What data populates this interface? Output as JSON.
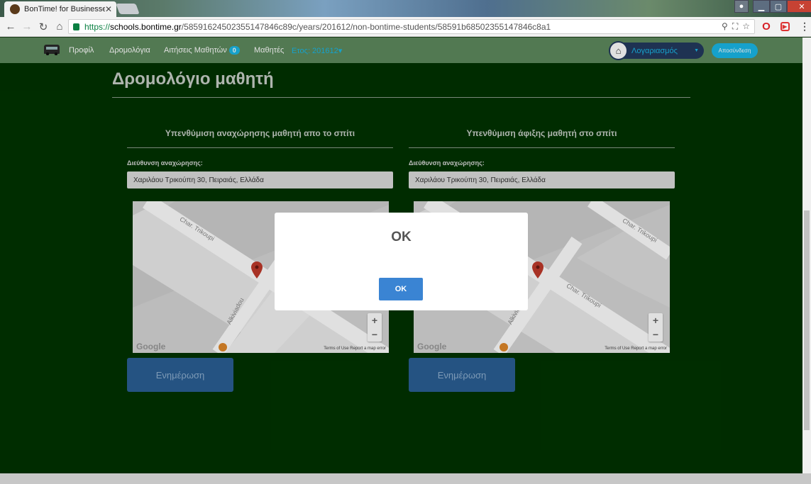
{
  "browser": {
    "tab_title": "BonTime! for Businesses",
    "tab_close": "✕",
    "url_scheme": "https://",
    "url_host": "schools.bontime.gr",
    "url_path": "/58591624502355147846c89c/years/201612/non-bontime-students/58591b68502355147846c8a1"
  },
  "site_nav": {
    "links": [
      "Προφίλ",
      "Δρομολόγια",
      "Αιτήσεις Μαθητών",
      "Μαθητές"
    ],
    "requests_badge": "0",
    "year_label": "Ετος: 201612▾",
    "account_label": "Λογαριασμός",
    "logout_label": "Αποσύνδεση"
  },
  "page": {
    "title": "Δρομολόγιο μαθητή"
  },
  "sections": [
    {
      "heading": "Υπενθύμιση αναχώρησης μαθητή απο το σπίτι",
      "address_label": "Διεύθυνση αναχώρησης:",
      "address_value": "Χαριλάου Τρικούπη 30, Πειραιάς, Ελλάδα",
      "update_label": "Ενημέρωση"
    },
    {
      "heading": "Υπενθύμιση άφιξης μαθητή στο σπίτι",
      "address_label": "Διεύθυνση αναχώρησης:",
      "address_value": "Χαριλάου Τρικούπη 30, Πειραιάς, Ελλάδα",
      "update_label": "Ενημέρωση"
    }
  ],
  "maps": [
    {
      "street_a": "Char. Trikoupi",
      "street_b": "Alkiviadou",
      "google": "Google",
      "terms": "Terms of Use   Report a map error",
      "zoom_in": "+",
      "zoom_out": "−"
    },
    {
      "street_a": "Char. Trikoupi",
      "street_b": "Alkiviadou",
      "street_c": "Char. Trikoupi",
      "google": "Google",
      "terms": "Terms of Use   Report a map error",
      "zoom_in": "+",
      "zoom_out": "−"
    }
  ],
  "modal": {
    "title": "OK",
    "button_label": "OK"
  },
  "colors": {
    "page_bg": "#003300",
    "nav_bg": "#5e8a5e",
    "accent": "#1ab8e8",
    "update_button": "#2b5f95",
    "modal_button": "#3a84d3"
  }
}
